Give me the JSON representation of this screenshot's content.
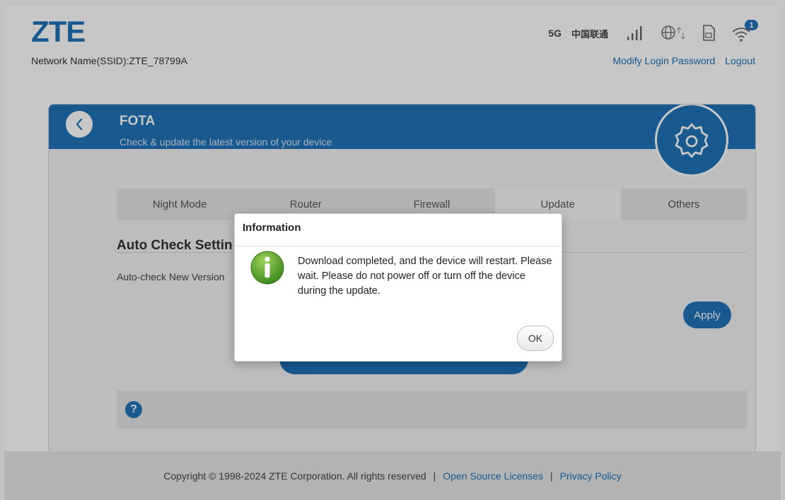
{
  "header": {
    "logo": "ZTE",
    "ssid": "Network Name(SSID):ZTE_78799A",
    "network_type": "5G",
    "operator": "中国联通",
    "wifi_badge": "1",
    "modify_password": "Modify Login Password",
    "logout": "Logout"
  },
  "card": {
    "title": "FOTA",
    "subtitle": "Check & update the latest version of your device"
  },
  "tabs": [
    {
      "label": "Night Mode"
    },
    {
      "label": "Router"
    },
    {
      "label": "Firewall"
    },
    {
      "label": "Update"
    },
    {
      "label": "Others"
    }
  ],
  "active_tab": "Update",
  "section": {
    "title": "Auto Check Settin",
    "auto_check_label": "Auto-check New Version",
    "apply_label": "Apply"
  },
  "help": {
    "icon": "?"
  },
  "footer": {
    "copyright": "Copyright © 1998-2024 ZTE Corporation. All rights reserved",
    "sep": "|",
    "open_source": "Open Source Licenses",
    "privacy": "Privacy Policy"
  },
  "dialog": {
    "title": "Information",
    "message": "Download completed, and the device will restart. Please wait. Please do not power off or turn off the device during the update.",
    "ok_label": "OK"
  },
  "colors": {
    "brand_blue": "#1f72b8",
    "info_green": "#5a9e2d"
  }
}
